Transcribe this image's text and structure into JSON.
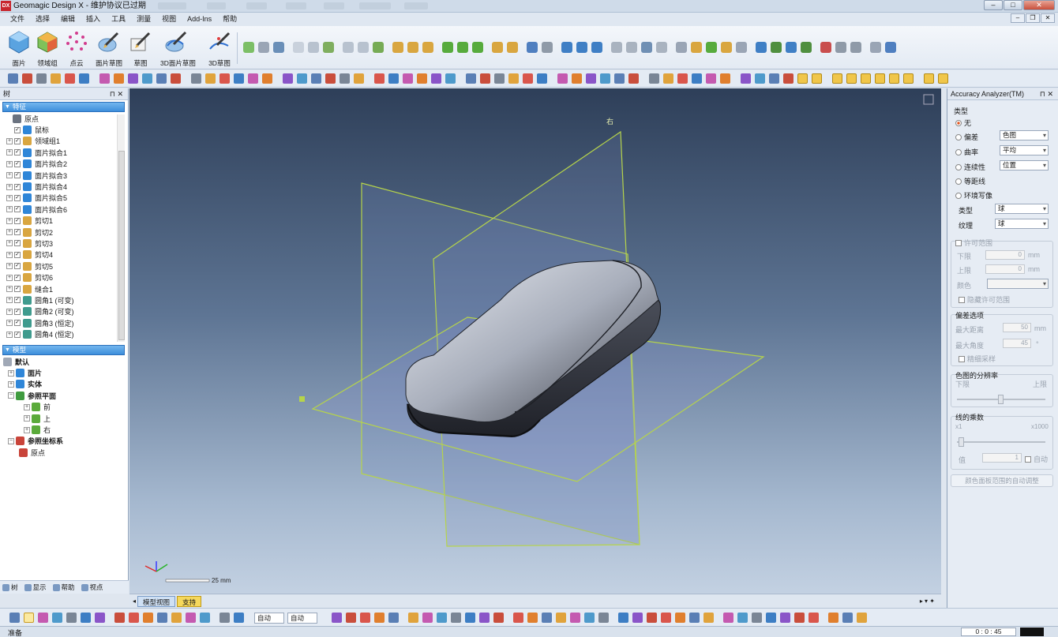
{
  "window": {
    "app_icon": "DX",
    "title": "Geomagic Design X - 维护协议已过期"
  },
  "menu": [
    "文件",
    "选择",
    "编辑",
    "插入",
    "工具",
    "测量",
    "视图",
    "Add-Ins",
    "帮助"
  ],
  "ribbon": {
    "big_tools": [
      {
        "label": "面片",
        "icon": "mesh-icon"
      },
      {
        "label": "领域组",
        "icon": "region-group-icon"
      },
      {
        "label": "点云",
        "icon": "point-cloud-icon"
      },
      {
        "label": "面片草图",
        "icon": "mesh-sketch-icon"
      },
      {
        "label": "草图",
        "icon": "sketch-icon"
      },
      {
        "label": "3D面片草图",
        "icon": "3d-mesh-sketch-icon"
      },
      {
        "label": "3D草图",
        "icon": "3d-sketch-icon"
      }
    ]
  },
  "left_panel": {
    "title": "树",
    "feature_section": "特征",
    "feature_items": [
      "原点",
      "鼠标",
      "领域组1",
      "面片拟合1",
      "面片拟合2",
      "面片拟合3",
      "面片拟合4",
      "面片拟合5",
      "面片拟合6",
      "剪切1",
      "剪切2",
      "剪切3",
      "剪切4",
      "剪切5",
      "剪切6",
      "缝合1",
      "圆角1 (可变)",
      "圆角2 (可变)",
      "圆角3 (恒定)",
      "圆角4 (恒定)"
    ],
    "model_section": "模型",
    "model_items": [
      "默认",
      "面片",
      "实体",
      "参照平面",
      "前",
      "上",
      "右",
      "参照坐标系",
      "原点"
    ],
    "bottom_tabs": [
      "树",
      "显示",
      "帮助",
      "视点"
    ]
  },
  "viewport": {
    "plane_label": "右",
    "scale_text": "25 mm"
  },
  "doc_tabs": [
    "模型视图",
    "支持"
  ],
  "right_panel": {
    "title": "Accuracy Analyzer(TM)",
    "type_label": "类型",
    "options": [
      "无",
      "偏差",
      "曲率",
      "连续性",
      "等距线",
      "环境写像"
    ],
    "combo_deviation": "色图",
    "combo_curvature": "平均",
    "combo_continuity": "位置",
    "shape_label": "类型",
    "shape_value": "球",
    "texture_label": "纹理",
    "texture_value": "球",
    "tolerance_title": "许可范围",
    "lower_label": "下限",
    "lower_value": "0",
    "upper_label": "上限",
    "upper_value": "0",
    "unit_mm": "mm",
    "color_label": "颜色",
    "hide_tolerance": "隐藏许可范围",
    "dev_options_title": "偏差选项",
    "max_dist_label": "最大距离",
    "max_dist_value": "50",
    "max_angle_label": "最大角度",
    "max_angle_value": "45",
    "angle_unit": "°",
    "fine_sampling": "精细采样",
    "resolution_title": "色图的分辨率",
    "res_low": "下限",
    "res_high": "上限",
    "line_title": "线的乘数",
    "line_min": "x1",
    "line_max": "x1000",
    "value_label": "值",
    "value_value": "1",
    "auto_label": "自动",
    "auto_adjust_button": "颜色面板范围的自动调整"
  },
  "bottom_toolbar": {
    "combo1": "自动",
    "combo2": "自动"
  },
  "status": {
    "text": "准备",
    "time": "0 : 0 : 45"
  }
}
